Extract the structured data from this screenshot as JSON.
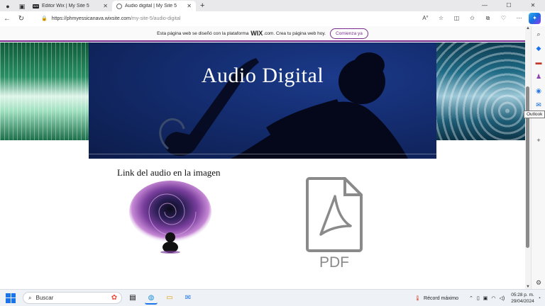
{
  "browser": {
    "tabs": [
      {
        "title": "Editor Wix | My Site 5",
        "active": false,
        "favicon": "wix-icon"
      },
      {
        "title": "Audio digital | My Site 5",
        "active": true,
        "favicon": "globe-icon"
      }
    ],
    "new_tab_glyph": "+",
    "address": {
      "domain": "https://phmyessicanava.wixsite.com",
      "path": "/my-site-5/audio-digital"
    },
    "window_controls": [
      "—",
      "☐",
      "✕"
    ]
  },
  "wix_banner": {
    "text_before": "Esta página web se diseñó con la plataforma",
    "brand": "WIX",
    "text_after": ".com. Crea tu página web hoy.",
    "button_label": "Comienza ya",
    "accent_color": "#7a2b8f"
  },
  "page": {
    "hero_title": "Audio Digital",
    "link_caption": "Link del audio en la imagen",
    "pdf_label": "PDF"
  },
  "edge_sidebar": {
    "tooltip": "Outlook"
  },
  "taskbar": {
    "search_placeholder": "Buscar",
    "record_label": "Récord máximo",
    "time": "05:28 p. m.",
    "date": "29/04/2024"
  }
}
